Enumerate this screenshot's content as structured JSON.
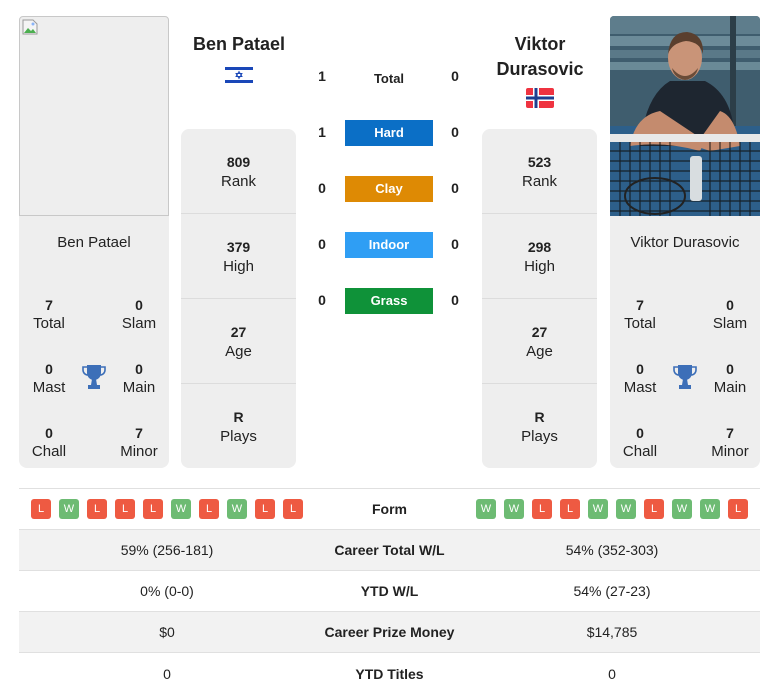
{
  "players": {
    "left": {
      "name": "Ben Patael",
      "country": "Israel",
      "flag_icon": "israel-flag",
      "photo": "broken-image",
      "stats": [
        {
          "value": "809",
          "label": "Rank"
        },
        {
          "value": "379",
          "label": "High"
        },
        {
          "value": "27",
          "label": "Age"
        },
        {
          "value": "R",
          "label": "Plays"
        }
      ],
      "titles": {
        "total": {
          "value": "7",
          "label": "Total"
        },
        "slam": {
          "value": "0",
          "label": "Slam"
        },
        "mast": {
          "value": "0",
          "label": "Mast"
        },
        "main": {
          "value": "0",
          "label": "Main"
        },
        "chall": {
          "value": "0",
          "label": "Chall"
        },
        "minor": {
          "value": "7",
          "label": "Minor"
        }
      },
      "form": [
        "L",
        "W",
        "L",
        "L",
        "L",
        "W",
        "L",
        "W",
        "L",
        "L"
      ]
    },
    "right": {
      "name": "Viktor Durasovic",
      "name_line1": "Viktor",
      "name_line2": "Durasovic",
      "country": "Norway",
      "flag_icon": "norway-flag",
      "photo": "player-photo",
      "stats": [
        {
          "value": "523",
          "label": "Rank"
        },
        {
          "value": "298",
          "label": "High"
        },
        {
          "value": "27",
          "label": "Age"
        },
        {
          "value": "R",
          "label": "Plays"
        }
      ],
      "titles": {
        "total": {
          "value": "7",
          "label": "Total"
        },
        "slam": {
          "value": "0",
          "label": "Slam"
        },
        "mast": {
          "value": "0",
          "label": "Mast"
        },
        "main": {
          "value": "0",
          "label": "Main"
        },
        "chall": {
          "value": "0",
          "label": "Chall"
        },
        "minor": {
          "value": "7",
          "label": "Minor"
        }
      },
      "form": [
        "W",
        "W",
        "L",
        "L",
        "W",
        "W",
        "L",
        "W",
        "W",
        "L"
      ]
    }
  },
  "h2h": [
    {
      "label": "Total",
      "left": "1",
      "right": "0",
      "color": ""
    },
    {
      "label": "Hard",
      "left": "1",
      "right": "0",
      "color": "#0b6fc6"
    },
    {
      "label": "Clay",
      "left": "0",
      "right": "0",
      "color": "#de8a04"
    },
    {
      "label": "Indoor",
      "left": "0",
      "right": "0",
      "color": "#2f9ef4"
    },
    {
      "label": "Grass",
      "left": "0",
      "right": "0",
      "color": "#0f9239"
    }
  ],
  "comparison": {
    "form_label": "Form",
    "rows": [
      {
        "label": "Career Total W/L",
        "left": "59% (256-181)",
        "right": "54% (352-303)"
      },
      {
        "label": "YTD W/L",
        "left": "0% (0-0)",
        "right": "54% (27-23)"
      },
      {
        "label": "Career Prize Money",
        "left": "$0",
        "right": "$14,785"
      },
      {
        "label": "YTD Titles",
        "left": "0",
        "right": "0"
      }
    ]
  },
  "colors": {
    "win": "#6dbb73",
    "loss": "#ee5a42",
    "trophy": "#3d6fb8"
  }
}
